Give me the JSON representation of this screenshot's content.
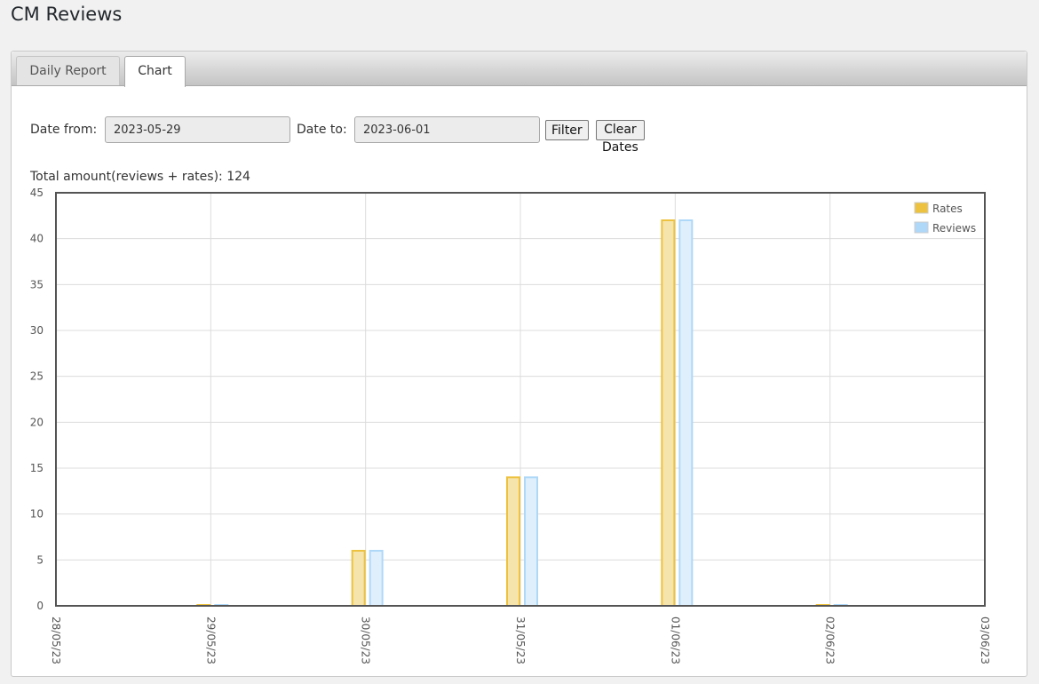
{
  "page": {
    "title": "CM Reviews"
  },
  "tabs": [
    {
      "label": "Daily Report",
      "active": false
    },
    {
      "label": "Chart",
      "active": true
    }
  ],
  "filter": {
    "date_from_label": "Date from:",
    "date_from_value": "2023-05-29",
    "date_to_label": "Date to:",
    "date_to_value": "2023-06-01",
    "filter_button": "Filter",
    "clear_button": "Clear Dates"
  },
  "total_text": "Total amount(reviews + rates): 124",
  "chart_data": {
    "type": "bar",
    "title": "",
    "xlabel": "",
    "ylabel": "",
    "ylim": [
      0,
      45
    ],
    "yticks": [
      0,
      5,
      10,
      15,
      20,
      25,
      30,
      35,
      40,
      45
    ],
    "x_ticks": [
      "28/05/23",
      "29/05/23",
      "30/05/23",
      "31/05/23",
      "01/06/23",
      "02/06/23",
      "03/06/23"
    ],
    "categories": [
      "29/05/23",
      "30/05/23",
      "31/05/23",
      "01/06/23",
      "02/06/23"
    ],
    "series": [
      {
        "name": "Rates",
        "values": [
          0,
          6,
          14,
          42,
          0
        ],
        "color": "#edc240",
        "fill": "#f6e4ad"
      },
      {
        "name": "Reviews",
        "values": [
          0,
          6,
          14,
          42,
          0
        ],
        "color": "#afd8f8",
        "fill": "#dff0fc"
      }
    ],
    "grid": true,
    "legend_position": "top-right"
  }
}
